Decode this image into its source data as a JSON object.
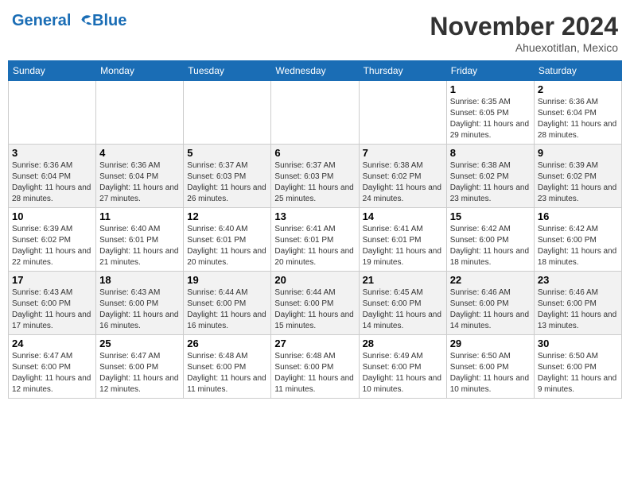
{
  "header": {
    "logo_line1": "General",
    "logo_line2": "Blue",
    "month": "November 2024",
    "location": "Ahuexotitlan, Mexico"
  },
  "days_of_week": [
    "Sunday",
    "Monday",
    "Tuesday",
    "Wednesday",
    "Thursday",
    "Friday",
    "Saturday"
  ],
  "weeks": [
    [
      {
        "num": "",
        "info": ""
      },
      {
        "num": "",
        "info": ""
      },
      {
        "num": "",
        "info": ""
      },
      {
        "num": "",
        "info": ""
      },
      {
        "num": "",
        "info": ""
      },
      {
        "num": "1",
        "info": "Sunrise: 6:35 AM\nSunset: 6:05 PM\nDaylight: 11 hours and 29 minutes."
      },
      {
        "num": "2",
        "info": "Sunrise: 6:36 AM\nSunset: 6:04 PM\nDaylight: 11 hours and 28 minutes."
      }
    ],
    [
      {
        "num": "3",
        "info": "Sunrise: 6:36 AM\nSunset: 6:04 PM\nDaylight: 11 hours and 28 minutes."
      },
      {
        "num": "4",
        "info": "Sunrise: 6:36 AM\nSunset: 6:04 PM\nDaylight: 11 hours and 27 minutes."
      },
      {
        "num": "5",
        "info": "Sunrise: 6:37 AM\nSunset: 6:03 PM\nDaylight: 11 hours and 26 minutes."
      },
      {
        "num": "6",
        "info": "Sunrise: 6:37 AM\nSunset: 6:03 PM\nDaylight: 11 hours and 25 minutes."
      },
      {
        "num": "7",
        "info": "Sunrise: 6:38 AM\nSunset: 6:02 PM\nDaylight: 11 hours and 24 minutes."
      },
      {
        "num": "8",
        "info": "Sunrise: 6:38 AM\nSunset: 6:02 PM\nDaylight: 11 hours and 23 minutes."
      },
      {
        "num": "9",
        "info": "Sunrise: 6:39 AM\nSunset: 6:02 PM\nDaylight: 11 hours and 23 minutes."
      }
    ],
    [
      {
        "num": "10",
        "info": "Sunrise: 6:39 AM\nSunset: 6:02 PM\nDaylight: 11 hours and 22 minutes."
      },
      {
        "num": "11",
        "info": "Sunrise: 6:40 AM\nSunset: 6:01 PM\nDaylight: 11 hours and 21 minutes."
      },
      {
        "num": "12",
        "info": "Sunrise: 6:40 AM\nSunset: 6:01 PM\nDaylight: 11 hours and 20 minutes."
      },
      {
        "num": "13",
        "info": "Sunrise: 6:41 AM\nSunset: 6:01 PM\nDaylight: 11 hours and 20 minutes."
      },
      {
        "num": "14",
        "info": "Sunrise: 6:41 AM\nSunset: 6:01 PM\nDaylight: 11 hours and 19 minutes."
      },
      {
        "num": "15",
        "info": "Sunrise: 6:42 AM\nSunset: 6:00 PM\nDaylight: 11 hours and 18 minutes."
      },
      {
        "num": "16",
        "info": "Sunrise: 6:42 AM\nSunset: 6:00 PM\nDaylight: 11 hours and 18 minutes."
      }
    ],
    [
      {
        "num": "17",
        "info": "Sunrise: 6:43 AM\nSunset: 6:00 PM\nDaylight: 11 hours and 17 minutes."
      },
      {
        "num": "18",
        "info": "Sunrise: 6:43 AM\nSunset: 6:00 PM\nDaylight: 11 hours and 16 minutes."
      },
      {
        "num": "19",
        "info": "Sunrise: 6:44 AM\nSunset: 6:00 PM\nDaylight: 11 hours and 16 minutes."
      },
      {
        "num": "20",
        "info": "Sunrise: 6:44 AM\nSunset: 6:00 PM\nDaylight: 11 hours and 15 minutes."
      },
      {
        "num": "21",
        "info": "Sunrise: 6:45 AM\nSunset: 6:00 PM\nDaylight: 11 hours and 14 minutes."
      },
      {
        "num": "22",
        "info": "Sunrise: 6:46 AM\nSunset: 6:00 PM\nDaylight: 11 hours and 14 minutes."
      },
      {
        "num": "23",
        "info": "Sunrise: 6:46 AM\nSunset: 6:00 PM\nDaylight: 11 hours and 13 minutes."
      }
    ],
    [
      {
        "num": "24",
        "info": "Sunrise: 6:47 AM\nSunset: 6:00 PM\nDaylight: 11 hours and 12 minutes."
      },
      {
        "num": "25",
        "info": "Sunrise: 6:47 AM\nSunset: 6:00 PM\nDaylight: 11 hours and 12 minutes."
      },
      {
        "num": "26",
        "info": "Sunrise: 6:48 AM\nSunset: 6:00 PM\nDaylight: 11 hours and 11 minutes."
      },
      {
        "num": "27",
        "info": "Sunrise: 6:48 AM\nSunset: 6:00 PM\nDaylight: 11 hours and 11 minutes."
      },
      {
        "num": "28",
        "info": "Sunrise: 6:49 AM\nSunset: 6:00 PM\nDaylight: 11 hours and 10 minutes."
      },
      {
        "num": "29",
        "info": "Sunrise: 6:50 AM\nSunset: 6:00 PM\nDaylight: 11 hours and 10 minutes."
      },
      {
        "num": "30",
        "info": "Sunrise: 6:50 AM\nSunset: 6:00 PM\nDaylight: 11 hours and 9 minutes."
      }
    ]
  ]
}
